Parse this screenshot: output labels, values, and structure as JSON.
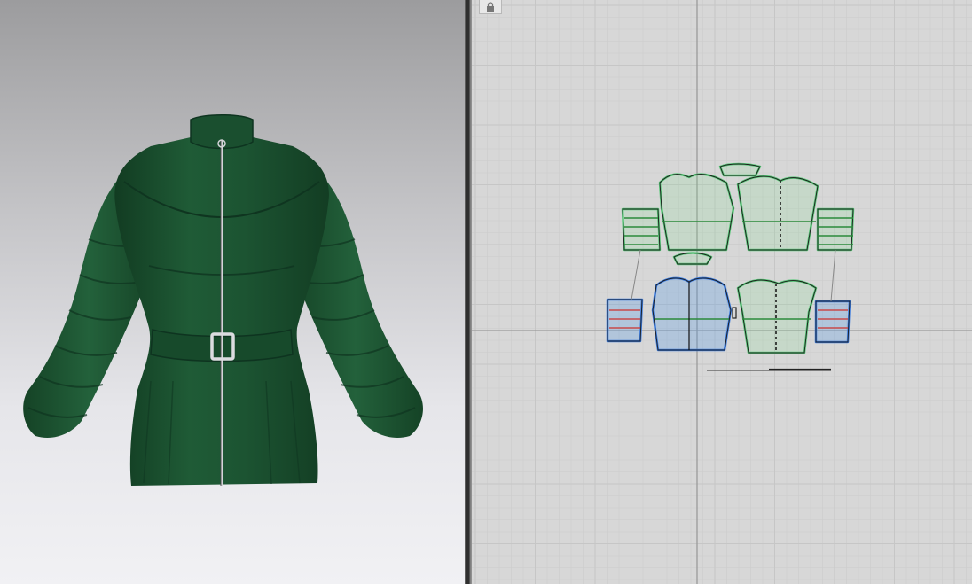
{
  "app": {
    "views": [
      "3d-avatar-window",
      "2d-pattern-window"
    ]
  },
  "garment": {
    "type": "belted puffer jacket",
    "color": "#1e5634",
    "hardware_color": "#c8c8cc"
  },
  "pattern_window": {
    "lock_icon": "lock-icon",
    "grid_color": "#c6c6c6",
    "axis_color": "#9a9a9a",
    "selected_piece_color": "#3a7be0",
    "piece_outline_color": "#58c878"
  }
}
